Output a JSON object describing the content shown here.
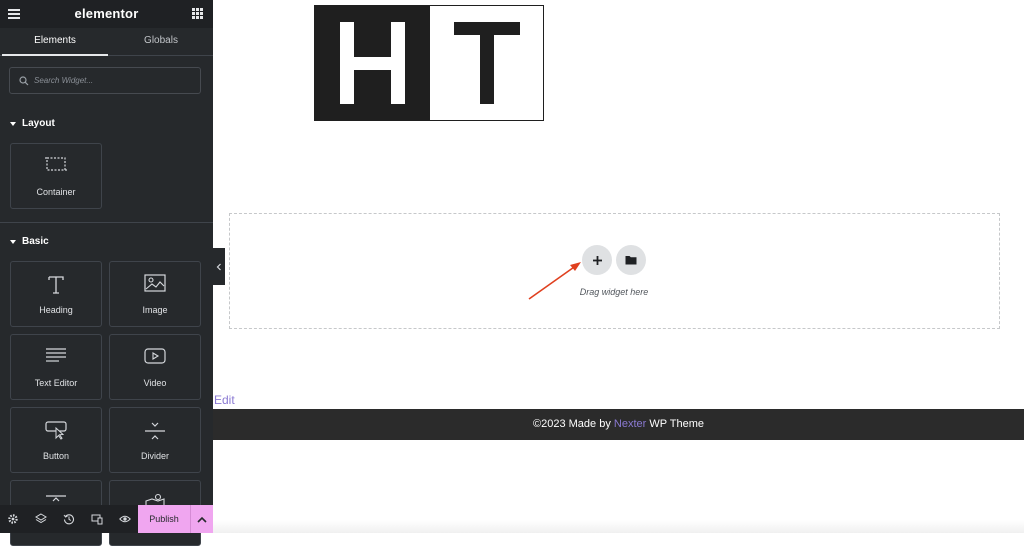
{
  "header": {
    "app_title": "elementor"
  },
  "tabs": [
    {
      "label": "Elements",
      "active": true
    },
    {
      "label": "Globals",
      "active": false
    }
  ],
  "search": {
    "placeholder": "Search Widget..."
  },
  "categories": {
    "layout": {
      "label": "Layout",
      "widgets": [
        {
          "label": "Container",
          "icon": "container-icon"
        }
      ]
    },
    "basic": {
      "label": "Basic",
      "widgets": [
        {
          "label": "Heading",
          "icon": "heading-icon"
        },
        {
          "label": "Image",
          "icon": "image-icon"
        },
        {
          "label": "Text Editor",
          "icon": "text-editor-icon"
        },
        {
          "label": "Video",
          "icon": "video-icon"
        },
        {
          "label": "Button",
          "icon": "button-icon"
        },
        {
          "label": "Divider",
          "icon": "divider-icon"
        }
      ]
    }
  },
  "bottombar": {
    "icons": [
      "settings-icon",
      "layers-icon",
      "history-icon",
      "responsive-icon",
      "preview-icon"
    ],
    "publish_label": "Publish"
  },
  "canvas": {
    "logo_letters": "HT",
    "dropzone_text": "Drag widget here",
    "edit_link": "Edit",
    "footer": {
      "prefix": "©2023 Made by ",
      "link": "Nexter",
      "suffix": " WP Theme"
    }
  },
  "colors": {
    "sidebar_bg": "#26292c",
    "topbar_bg": "#1f2124",
    "publish_bg": "#f0a6f0",
    "footer_bg": "#2b2b2b",
    "link": "#8b7ad3",
    "annotation_arrow": "#e0401f"
  }
}
